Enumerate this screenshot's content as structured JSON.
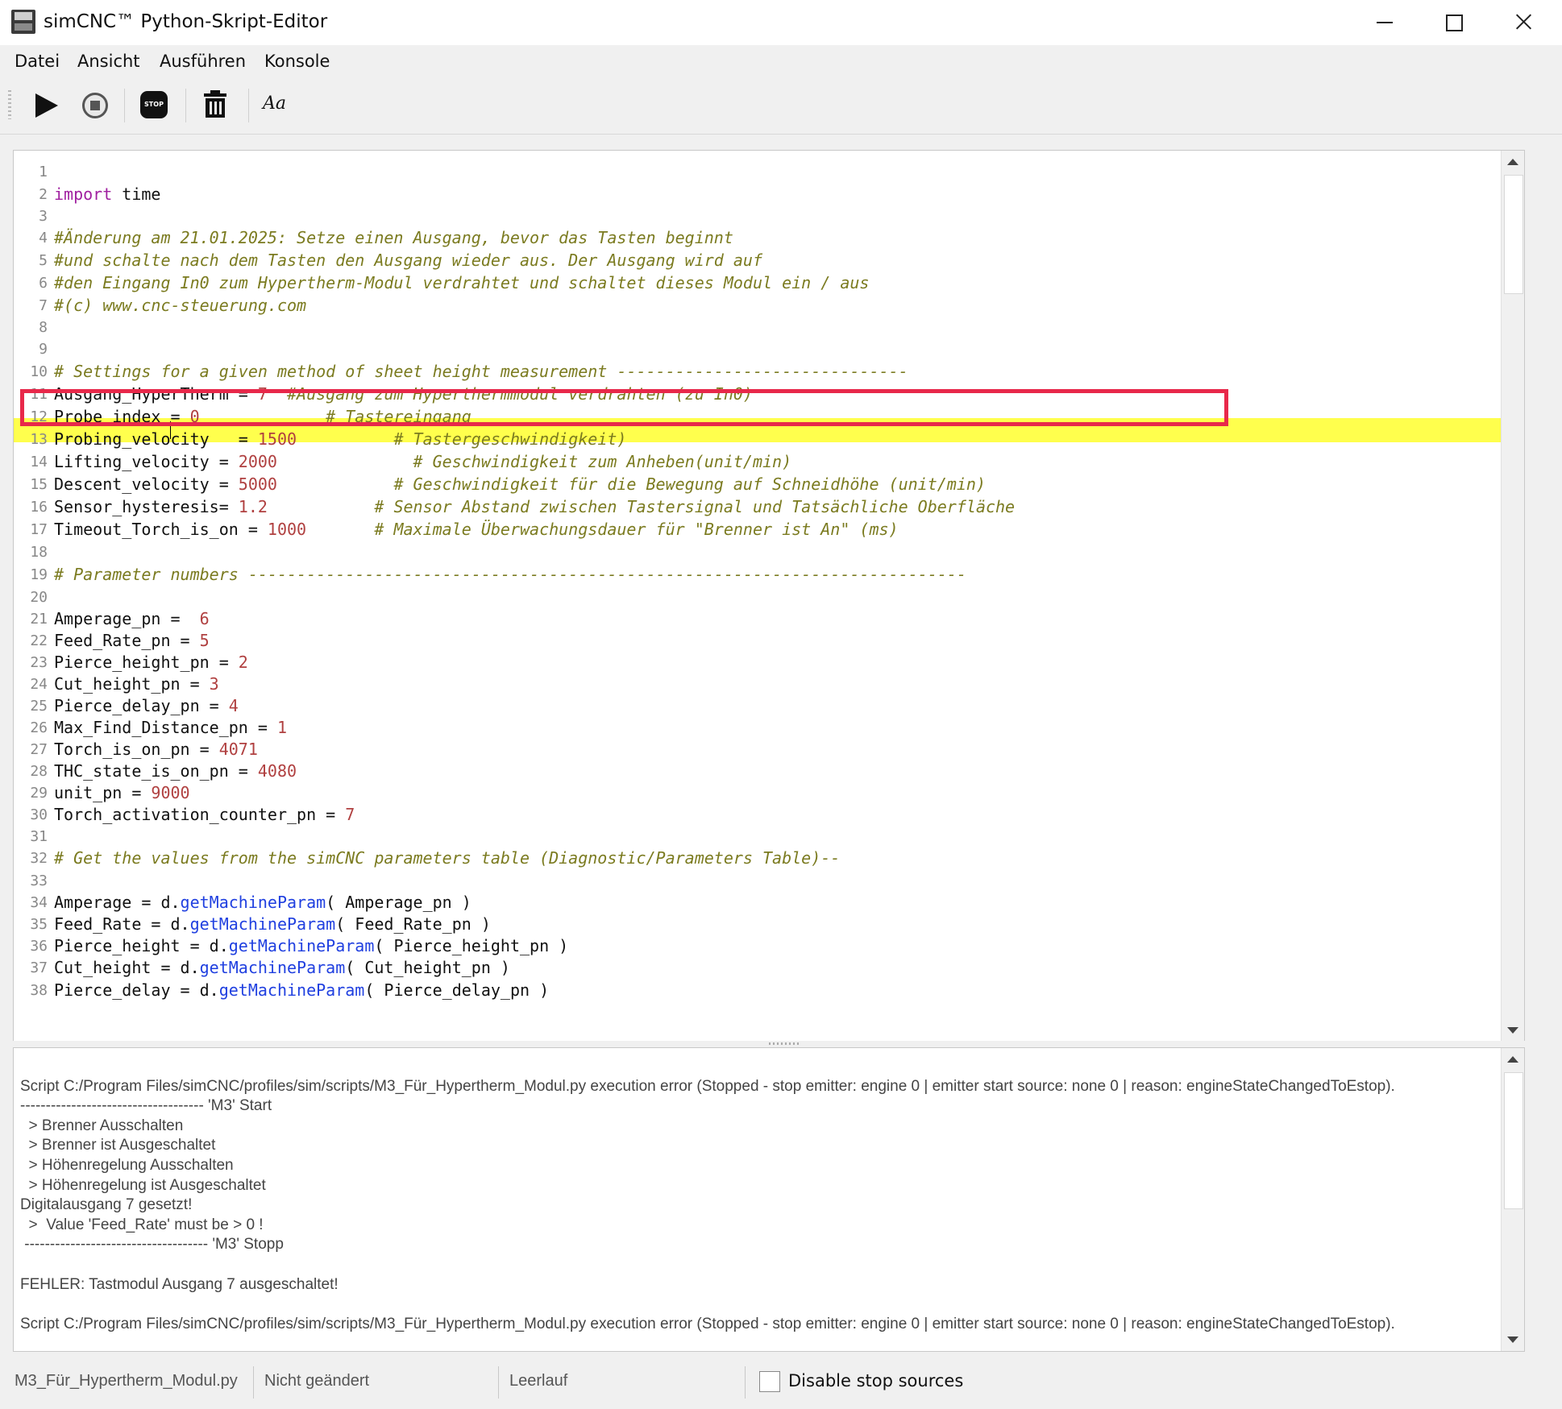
{
  "window": {
    "title": "simCNC™ Python-Skript-Editor",
    "icon": "simcnc-app-icon",
    "controls": [
      "minimize",
      "maximize",
      "close"
    ]
  },
  "menu": {
    "items": [
      {
        "label": "Datei"
      },
      {
        "label": "Ansicht"
      },
      {
        "label": "Ausführen"
      },
      {
        "label": "Konsole"
      }
    ]
  },
  "toolbar": {
    "buttons": [
      {
        "icon": "play-icon",
        "name": "run"
      },
      {
        "icon": "pause-icon",
        "name": "pause"
      },
      {
        "icon": "stop-icon",
        "name": "stop",
        "text": "STOP"
      },
      {
        "icon": "trash-icon",
        "name": "clear"
      },
      {
        "icon": "font-icon",
        "name": "font",
        "text": "Aa"
      }
    ]
  },
  "editor": {
    "highlighted_line": 12,
    "boxed_line": 11,
    "lines": [
      {
        "n": "1",
        "parts": []
      },
      {
        "n": "2",
        "parts": [
          {
            "t": "import",
            "c": "kw"
          },
          {
            "t": " time",
            "c": ""
          }
        ]
      },
      {
        "n": "3",
        "parts": []
      },
      {
        "n": "4",
        "parts": [
          {
            "t": "#Änderung am 21.01.2025: Setze einen Ausgang, bevor das Tasten beginnt",
            "c": "cm"
          }
        ]
      },
      {
        "n": "5",
        "parts": [
          {
            "t": "#und schalte nach dem Tasten den Ausgang wieder aus. Der Ausgang wird auf",
            "c": "cm"
          }
        ]
      },
      {
        "n": "6",
        "parts": [
          {
            "t": "#den Eingang In0 zum Hypertherm-Modul verdrahtet und schaltet dieses Modul ein / aus",
            "c": "cm"
          }
        ]
      },
      {
        "n": "7",
        "parts": [
          {
            "t": "#(c) www.cnc-steuerung.com",
            "c": "cm"
          }
        ]
      },
      {
        "n": "8",
        "parts": []
      },
      {
        "n": "9",
        "parts": []
      },
      {
        "n": "10",
        "parts": [
          {
            "t": "# Settings for a given method of sheet height measurement ------------------------------",
            "c": "cm"
          }
        ]
      },
      {
        "n": "11",
        "parts": [
          {
            "t": "Ausgang_HyperTherm = ",
            "c": ""
          },
          {
            "t": "7",
            "c": "num"
          },
          {
            "t": "  #Ausgang zum Hyperthermmodul verdrahten (zu In0)",
            "c": "cm"
          }
        ]
      },
      {
        "n": "12",
        "parts": [
          {
            "t": "Probe_index = ",
            "c": ""
          },
          {
            "t": "0",
            "c": "num"
          },
          {
            "t": "             # Tastereingang",
            "c": "cm"
          }
        ]
      },
      {
        "n": "13",
        "parts": [
          {
            "t": "Probing_velocity   = ",
            "c": ""
          },
          {
            "t": "1500",
            "c": "num"
          },
          {
            "t": "          # Tastergeschwindigkeit)",
            "c": "cm"
          }
        ]
      },
      {
        "n": "14",
        "parts": [
          {
            "t": "Lifting_velocity = ",
            "c": ""
          },
          {
            "t": "2000",
            "c": "num"
          },
          {
            "t": "              # Geschwindigkeit zum Anheben(unit/min)",
            "c": "cm"
          }
        ]
      },
      {
        "n": "15",
        "parts": [
          {
            "t": "Descent_velocity = ",
            "c": ""
          },
          {
            "t": "5000",
            "c": "num"
          },
          {
            "t": "            # Geschwindigkeit für die Bewegung auf Schneidhöhe (unit/min)",
            "c": "cm"
          }
        ]
      },
      {
        "n": "16",
        "parts": [
          {
            "t": "Sensor_hysteresis= ",
            "c": ""
          },
          {
            "t": "1.2",
            "c": "num"
          },
          {
            "t": "           # Sensor Abstand zwischen Tastersignal und Tatsächliche Oberfläche",
            "c": "cm"
          }
        ]
      },
      {
        "n": "17",
        "parts": [
          {
            "t": "Timeout_Torch_is_on = ",
            "c": ""
          },
          {
            "t": "1000",
            "c": "num"
          },
          {
            "t": "       # Maximale Überwachungsdauer für \"Brenner ist An\" (ms)",
            "c": "cm"
          }
        ]
      },
      {
        "n": "18",
        "parts": []
      },
      {
        "n": "19",
        "parts": [
          {
            "t": "# Parameter numbers --------------------------------------------------------------------------",
            "c": "cm"
          }
        ]
      },
      {
        "n": "20",
        "parts": []
      },
      {
        "n": "21",
        "parts": [
          {
            "t": "Amperage_pn =  ",
            "c": ""
          },
          {
            "t": "6",
            "c": "num"
          }
        ]
      },
      {
        "n": "22",
        "parts": [
          {
            "t": "Feed_Rate_pn = ",
            "c": ""
          },
          {
            "t": "5",
            "c": "num"
          }
        ]
      },
      {
        "n": "23",
        "parts": [
          {
            "t": "Pierce_height_pn = ",
            "c": ""
          },
          {
            "t": "2",
            "c": "num"
          }
        ]
      },
      {
        "n": "24",
        "parts": [
          {
            "t": "Cut_height_pn = ",
            "c": ""
          },
          {
            "t": "3",
            "c": "num"
          }
        ]
      },
      {
        "n": "25",
        "parts": [
          {
            "t": "Pierce_delay_pn = ",
            "c": ""
          },
          {
            "t": "4",
            "c": "num"
          }
        ]
      },
      {
        "n": "26",
        "parts": [
          {
            "t": "Max_Find_Distance_pn = ",
            "c": ""
          },
          {
            "t": "1",
            "c": "num"
          }
        ]
      },
      {
        "n": "27",
        "parts": [
          {
            "t": "Torch_is_on_pn = ",
            "c": ""
          },
          {
            "t": "4071",
            "c": "num"
          }
        ]
      },
      {
        "n": "28",
        "parts": [
          {
            "t": "THC_state_is_on_pn = ",
            "c": ""
          },
          {
            "t": "4080",
            "c": "num"
          }
        ]
      },
      {
        "n": "29",
        "parts": [
          {
            "t": "unit_pn = ",
            "c": ""
          },
          {
            "t": "9000",
            "c": "num"
          }
        ]
      },
      {
        "n": "30",
        "parts": [
          {
            "t": "Torch_activation_counter_pn = ",
            "c": ""
          },
          {
            "t": "7",
            "c": "num"
          }
        ]
      },
      {
        "n": "31",
        "parts": []
      },
      {
        "n": "32",
        "parts": [
          {
            "t": "# Get the values from the simCNC parameters table (Diagnostic/Parameters Table)--",
            "c": "cm"
          }
        ]
      },
      {
        "n": "33",
        "parts": []
      },
      {
        "n": "34",
        "parts": [
          {
            "t": "Amperage = d.",
            "c": ""
          },
          {
            "t": "getMachineParam",
            "c": "fn"
          },
          {
            "t": "( Amperage_pn )",
            "c": ""
          }
        ]
      },
      {
        "n": "35",
        "parts": [
          {
            "t": "Feed_Rate = d.",
            "c": ""
          },
          {
            "t": "getMachineParam",
            "c": "fn"
          },
          {
            "t": "( Feed_Rate_pn )",
            "c": ""
          }
        ]
      },
      {
        "n": "36",
        "parts": [
          {
            "t": "Pierce_height = d.",
            "c": ""
          },
          {
            "t": "getMachineParam",
            "c": "fn"
          },
          {
            "t": "( Pierce_height_pn )",
            "c": ""
          }
        ]
      },
      {
        "n": "37",
        "parts": [
          {
            "t": "Cut_height = d.",
            "c": ""
          },
          {
            "t": "getMachineParam",
            "c": "fn"
          },
          {
            "t": "( Cut_height_pn )",
            "c": ""
          }
        ]
      },
      {
        "n": "38",
        "parts": [
          {
            "t": "Pierce_delay = d.",
            "c": ""
          },
          {
            "t": "getMachineParam",
            "c": "fn"
          },
          {
            "t": "( Pierce_delay_pn )",
            "c": ""
          }
        ]
      }
    ]
  },
  "console": {
    "lines": [
      "",
      "Script C:/Program Files/simCNC/profiles/sim/scripts/M3_Für_Hypertherm_Modul.py execution error (Stopped - stop emitter: engine 0 | emitter start source: none 0 | reason: engineStateChangedToEstop).",
      "------------------------------------ 'M3' Start",
      "  > Brenner Ausschalten",
      "  > Brenner ist Ausgeschaltet",
      "  > Höhenregelung Ausschalten",
      "  > Höhenregelung ist Ausgeschaltet",
      "Digitalausgang 7 gesetzt!",
      "  >  Value 'Feed_Rate' must be > 0 !",
      " ------------------------------------ 'M3' Stopp",
      "",
      "FEHLER: Tastmodul Ausgang 7 ausgeschaltet!",
      "",
      "Script C:/Program Files/simCNC/profiles/sim/scripts/M3_Für_Hypertherm_Modul.py execution error (Stopped - stop emitter: engine 0 | emitter start source: none 0 | reason: engineStateChangedToEstop)."
    ]
  },
  "status": {
    "file": "M3_Für_Hypertherm_Modul.py",
    "modified": "Nicht geändert",
    "state": "Leerlauf",
    "disable_stop_sources_label": "Disable stop sources",
    "disable_stop_sources_checked": false
  }
}
